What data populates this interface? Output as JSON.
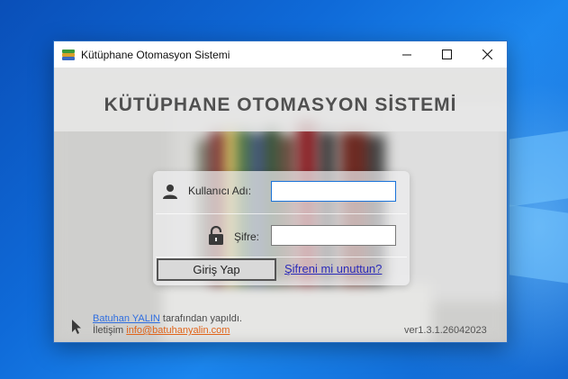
{
  "window": {
    "title": "Kütüphane Otomasyon Sistemi",
    "controls": {
      "minimize": "minimize",
      "maximize": "maximize",
      "close": "close"
    }
  },
  "header": {
    "heading": "KÜTÜPHANE OTOMASYON SİSTEMİ"
  },
  "login": {
    "username_label": "Kullanıcı Adı:",
    "username_value": "",
    "password_label": "Şifre:",
    "password_value": "",
    "submit_label": "Giriş Yap",
    "forgot_label": "Şifreni mi unuttun?"
  },
  "footer": {
    "author_name": "Batuhan YALIN",
    "author_suffix": " tarafından yapıldı.",
    "contact_prefix": "İletişim ",
    "contact_email": "info@batuhanyalin.com",
    "version": "ver1.3.1.26042023"
  },
  "icons": {
    "app": "books-stack-icon",
    "user": "user-icon",
    "lock": "lock-icon",
    "cursor": "mouse-cursor-icon"
  },
  "colors": {
    "desktop": "#0f6ad8",
    "input_focus_border": "#1a73d9",
    "link": "#2b2bb8",
    "email_link": "#e0641a"
  }
}
